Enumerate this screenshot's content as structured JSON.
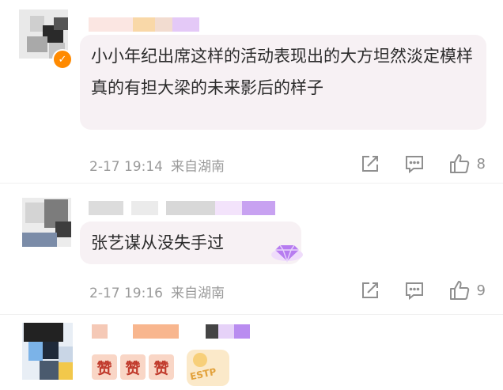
{
  "comments": [
    {
      "text": "小小年纪出席这样的活动表现出的大方坦然淡定模样 真的有担大梁的未来影后的样子",
      "time": "2-17 19:14",
      "location": "来自湖南",
      "likes": "8"
    },
    {
      "text": "张艺谋从没失手过",
      "time": "2-17 19:16",
      "location": "来自湖南",
      "likes": "9"
    }
  ],
  "third": {
    "stickers": [
      "赞",
      "赞",
      "赞"
    ],
    "badge": "ESTP"
  },
  "icons": {
    "share": "share-icon",
    "comment": "comment-icon",
    "like": "like-icon",
    "verified": "verified-badge-icon",
    "gem": "gem-icon"
  },
  "colors": {
    "bubble": "#f7f1f4",
    "meta": "#9a9a9a",
    "verified": "#ff8a00",
    "accent": "#b77cf0"
  }
}
